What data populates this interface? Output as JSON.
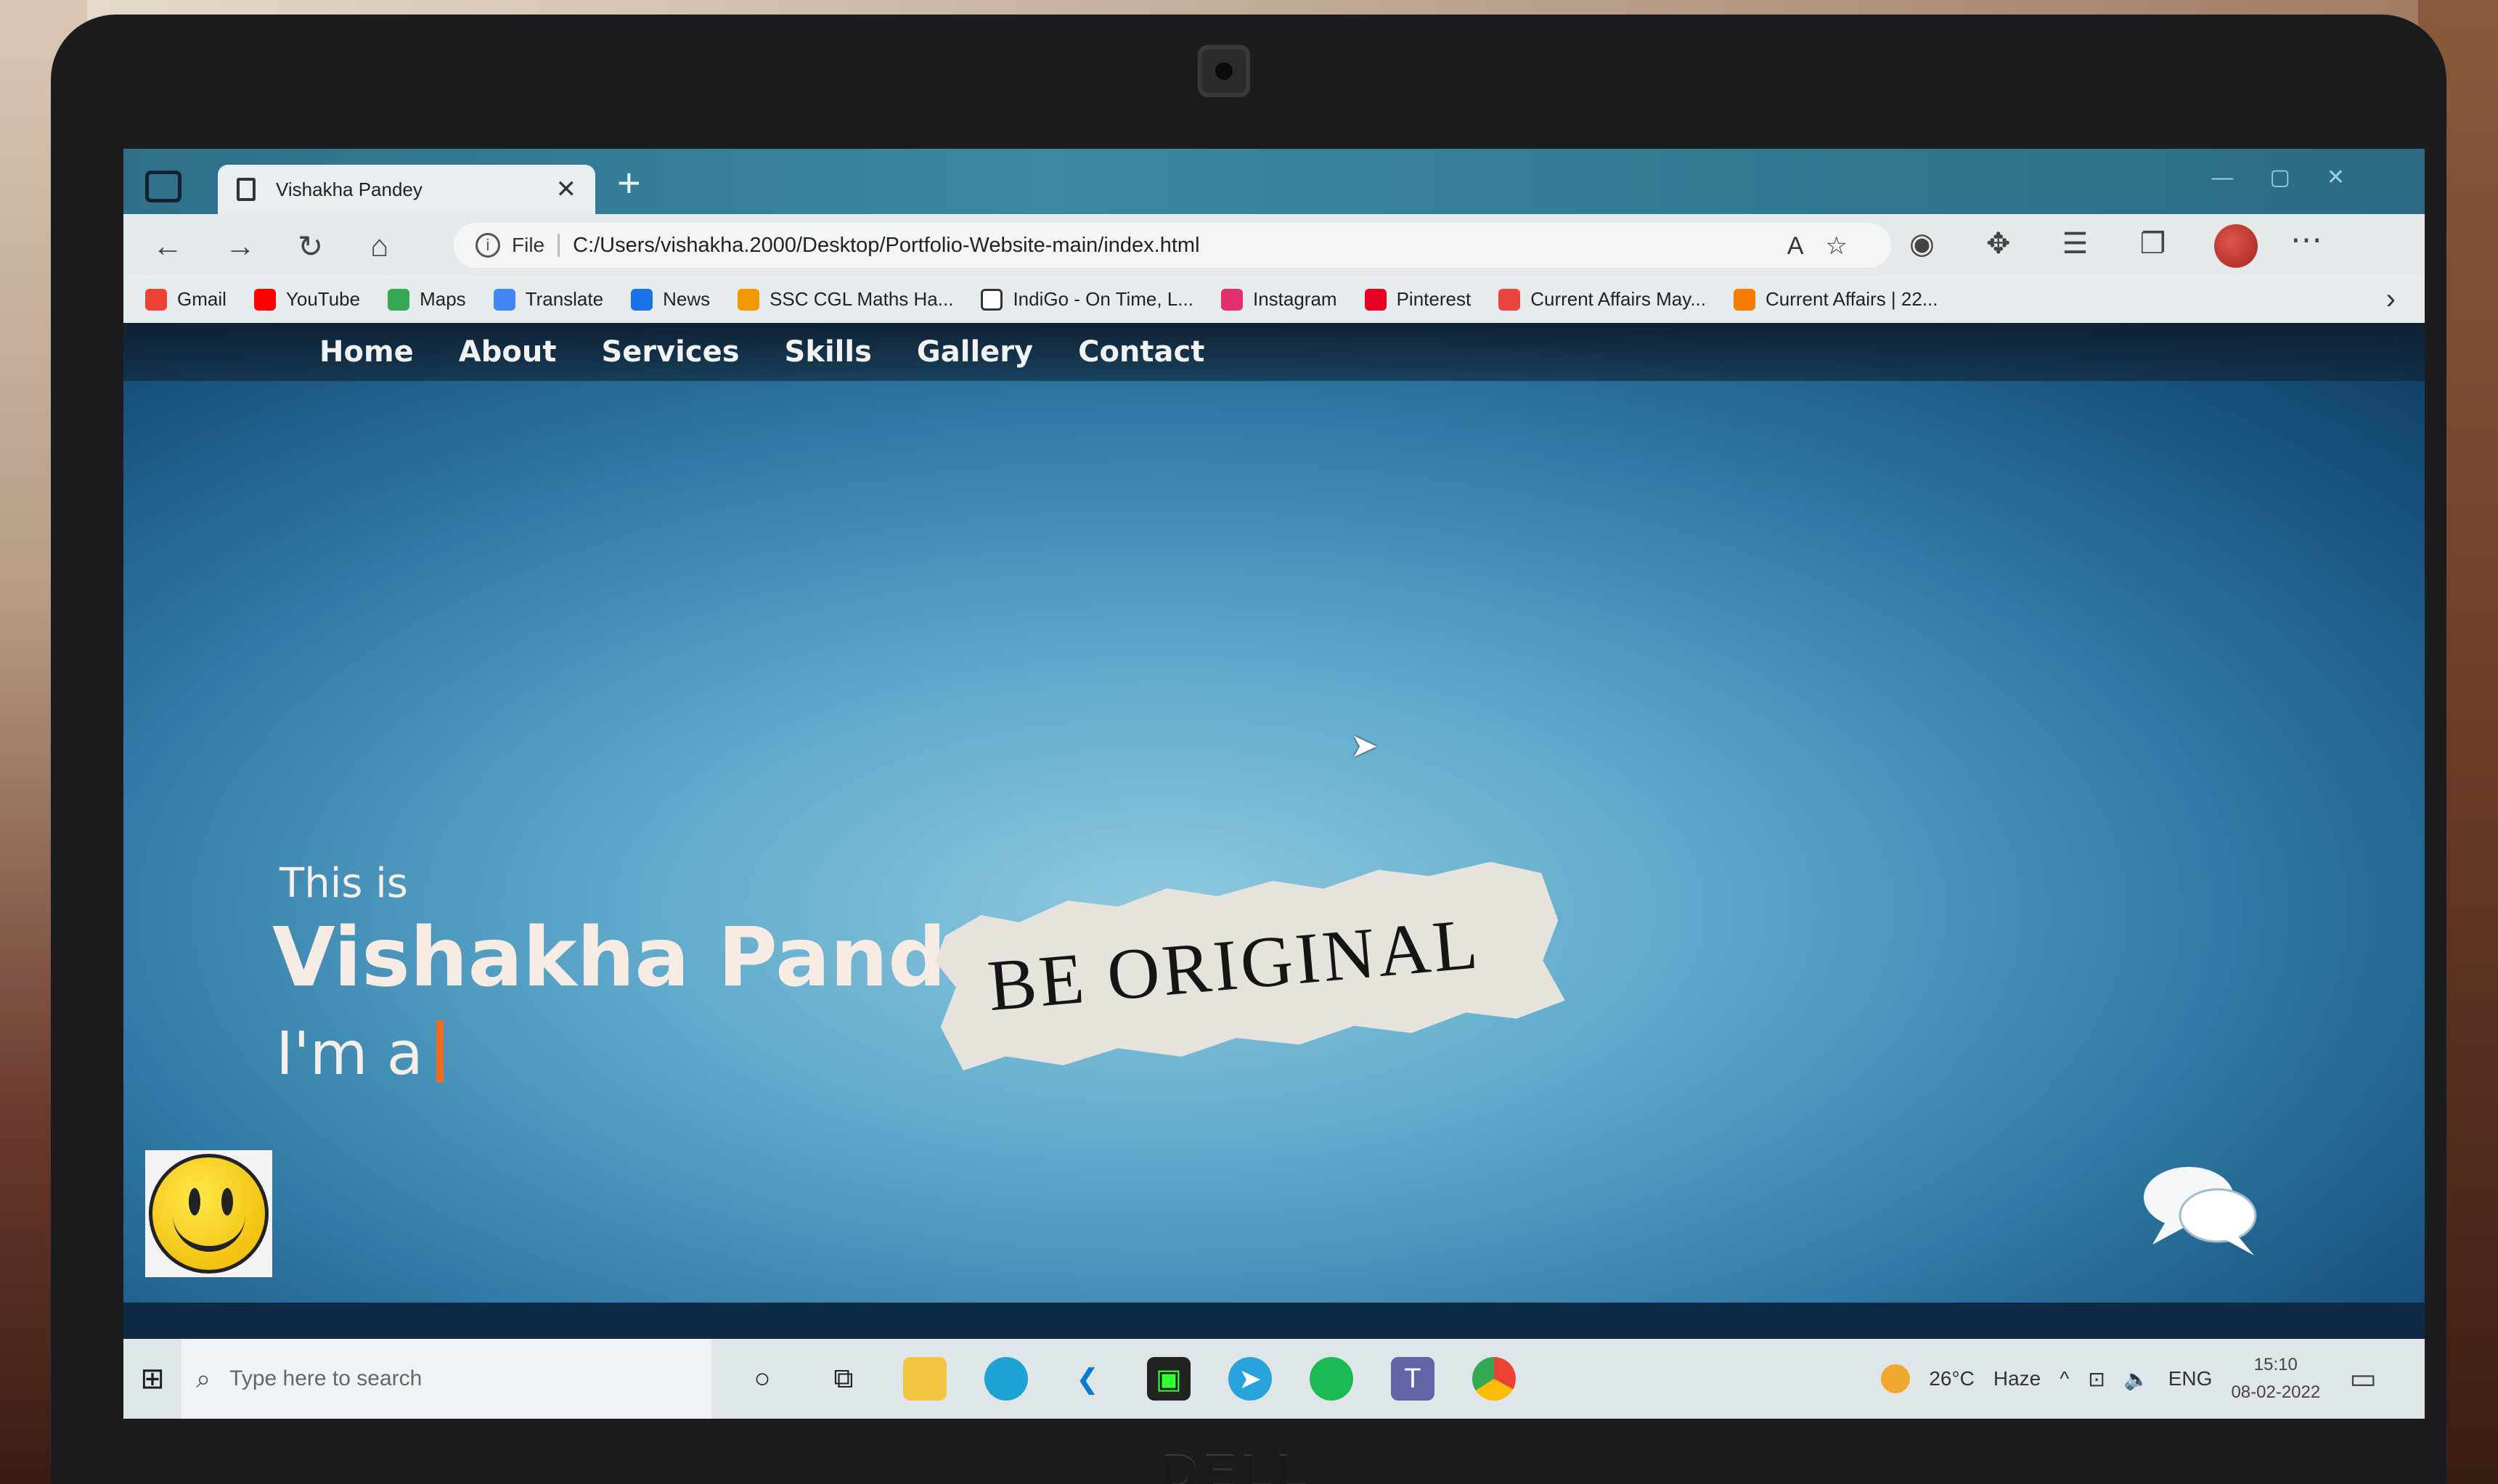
{
  "browser": {
    "tab_title": "Vishakha Pandey",
    "tab_close": "✕",
    "new_tab": "+",
    "address_scheme": "File",
    "url": "C:/Users/vishakha.2000/Desktop/Portfolio-Website-main/index.html",
    "bookmarks": [
      {
        "label": "Gmail",
        "color": "#ea4335"
      },
      {
        "label": "YouTube",
        "color": "#ff0000"
      },
      {
        "label": "Maps",
        "color": "#34a853"
      },
      {
        "label": "Translate",
        "color": "#4285f4"
      },
      {
        "label": "News",
        "color": "#1a73e8"
      },
      {
        "label": "SSC CGL Maths Ha...",
        "color": "#f29900"
      },
      {
        "label": "IndiGo - On Time, L...",
        "color": "#ffffff"
      },
      {
        "label": "Instagram",
        "color": "#e1306c"
      },
      {
        "label": "Pinterest",
        "color": "#e60023"
      },
      {
        "label": "Current Affairs May...",
        "color": "#e8453c"
      },
      {
        "label": "Current Affairs | 22...",
        "color": "#f57c00"
      }
    ]
  },
  "site": {
    "nav": [
      "Home",
      "About",
      "Services",
      "Skills",
      "Gallery",
      "Contact"
    ],
    "intro": "This is",
    "name": "Vishakha Pandey",
    "role_prefix": "I'm a",
    "paper_text": "BE ORIGINAL"
  },
  "taskbar": {
    "search_placeholder": "Type here to search",
    "weather_temp": "26°C",
    "weather_desc": "Haze",
    "language": "ENG",
    "time": "15:10",
    "date": "08-02-2022"
  },
  "brand": "DELL"
}
